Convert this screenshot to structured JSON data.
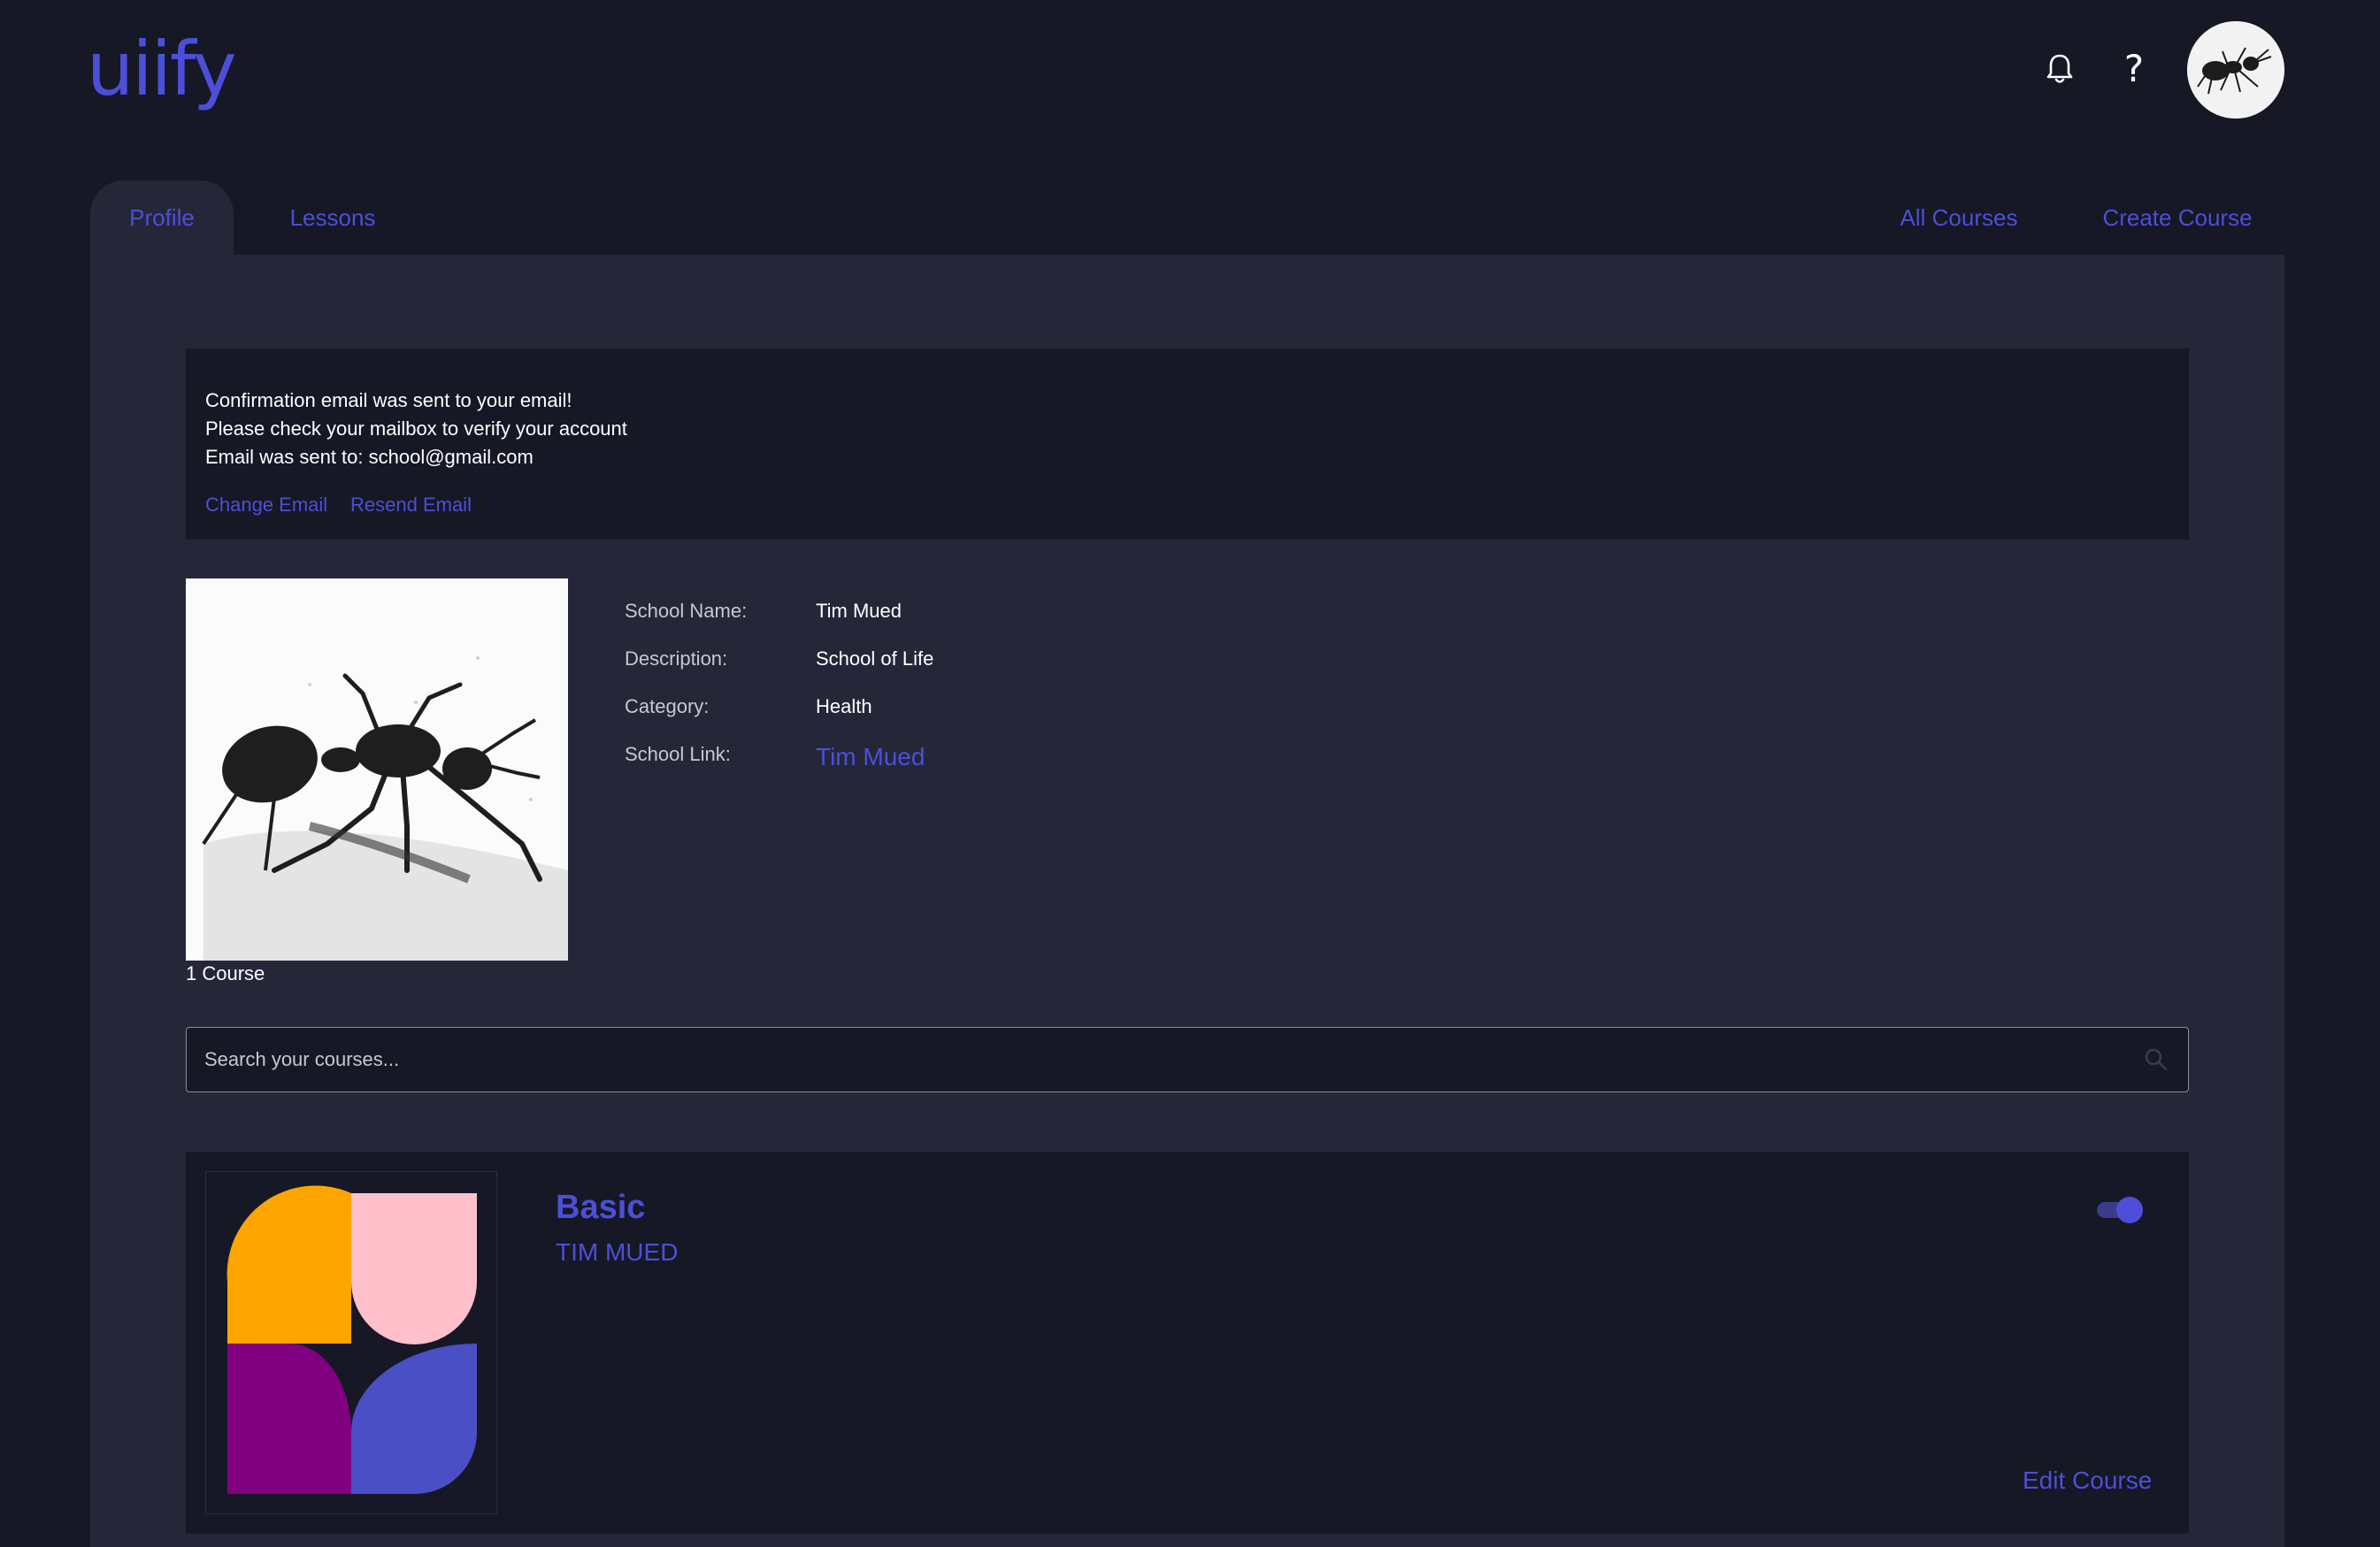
{
  "header": {
    "logo_text": "uiify",
    "help_label": "?"
  },
  "tabs": {
    "profile": "Profile",
    "lessons": "Lessons",
    "all_courses": "All Courses",
    "create_course": "Create Course"
  },
  "notice": {
    "line1": "Confirmation email was sent to your email!",
    "line2": "Please check your mailbox to verify your account",
    "line3": "Email was sent to: school@gmail.com",
    "change_email": "Change Email",
    "resend_email": "Resend Email"
  },
  "profile": {
    "course_count": "1 Course",
    "fields": [
      {
        "label": "School Name:",
        "value": "Tim Mued"
      },
      {
        "label": "Description:",
        "value": "School of Life"
      },
      {
        "label": "Category:",
        "value": "Health"
      },
      {
        "label": "School Link:",
        "value": "Tim Mued"
      }
    ]
  },
  "search": {
    "placeholder": "Search your courses..."
  },
  "course": {
    "title": "Basic",
    "author": "TIM MUED",
    "published": true,
    "edit_label": "Edit Course",
    "thumb_colors": [
      "#ffa500",
      "#ffc0cb",
      "#800080",
      "#4b4fc6"
    ]
  },
  "colors": {
    "accent": "#4d4fd8",
    "background": "#161826",
    "panel": "#252739"
  }
}
